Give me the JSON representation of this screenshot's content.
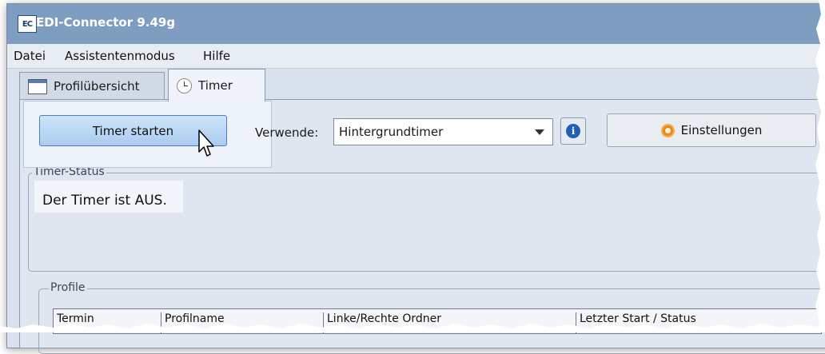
{
  "window": {
    "title": "EDI-Connector 9.49g",
    "icon_letters_1": "EC",
    "icon_letters_2": ""
  },
  "menu": {
    "items": [
      "Datei",
      "Assistentenmodus",
      "Hilfe"
    ]
  },
  "tabs": [
    {
      "label": "Profilübersicht",
      "active": false,
      "icon": "window-icon"
    },
    {
      "label": "Timer",
      "active": true,
      "icon": "clock-icon"
    }
  ],
  "toolbar": {
    "start_label": "Timer starten",
    "use_label": "Verwende:",
    "use_value": "Hintergrundtimer",
    "info_label": "i",
    "settings_label": "Einstellungen"
  },
  "status": {
    "legend": "Timer-Status",
    "text": "Der Timer ist AUS."
  },
  "profiles": {
    "legend": "Profile",
    "columns": [
      "Termin",
      "Profilname",
      "Linke/Rechte Ordner",
      "Letzter Start / Status"
    ]
  },
  "colors": {
    "titlebar": "#7f9cc1",
    "accent_button": "#a9cbef",
    "info": "#1f5fb8",
    "gear": "#e48a16"
  }
}
